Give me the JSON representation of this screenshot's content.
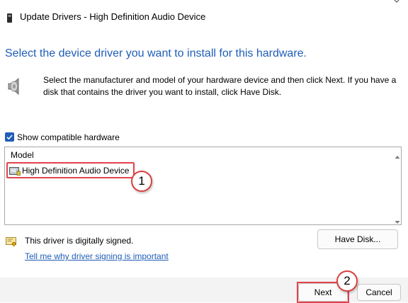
{
  "window": {
    "title": "Update Drivers - High Definition Audio Device"
  },
  "heading": "Select the device driver you want to install for this hardware.",
  "description": "Select the manufacturer and model of your hardware device and then click Next. If you have a disk that contains the driver you want to install, click Have Disk.",
  "options": {
    "show_compatible_label": "Show compatible hardware",
    "show_compatible_checked": true
  },
  "model_list": {
    "header": "Model",
    "items": [
      {
        "label": "High Definition Audio Device",
        "selected": true
      }
    ]
  },
  "signing": {
    "status_text": "This driver is digitally signed.",
    "link_text": "Tell me why driver signing is important"
  },
  "buttons": {
    "have_disk": "Have Disk...",
    "next": "Next",
    "cancel": "Cancel"
  },
  "callouts": {
    "step1": "1",
    "step2": "2"
  },
  "colors": {
    "heading": "#1f5db8",
    "link": "#1f5db8",
    "accent": "#1f5db8",
    "highlight": "#e0434e"
  },
  "icons": {
    "title": "device-icon",
    "description": "speaker-icon",
    "row": "hardware-device-icon",
    "signed": "certificate-icon"
  }
}
